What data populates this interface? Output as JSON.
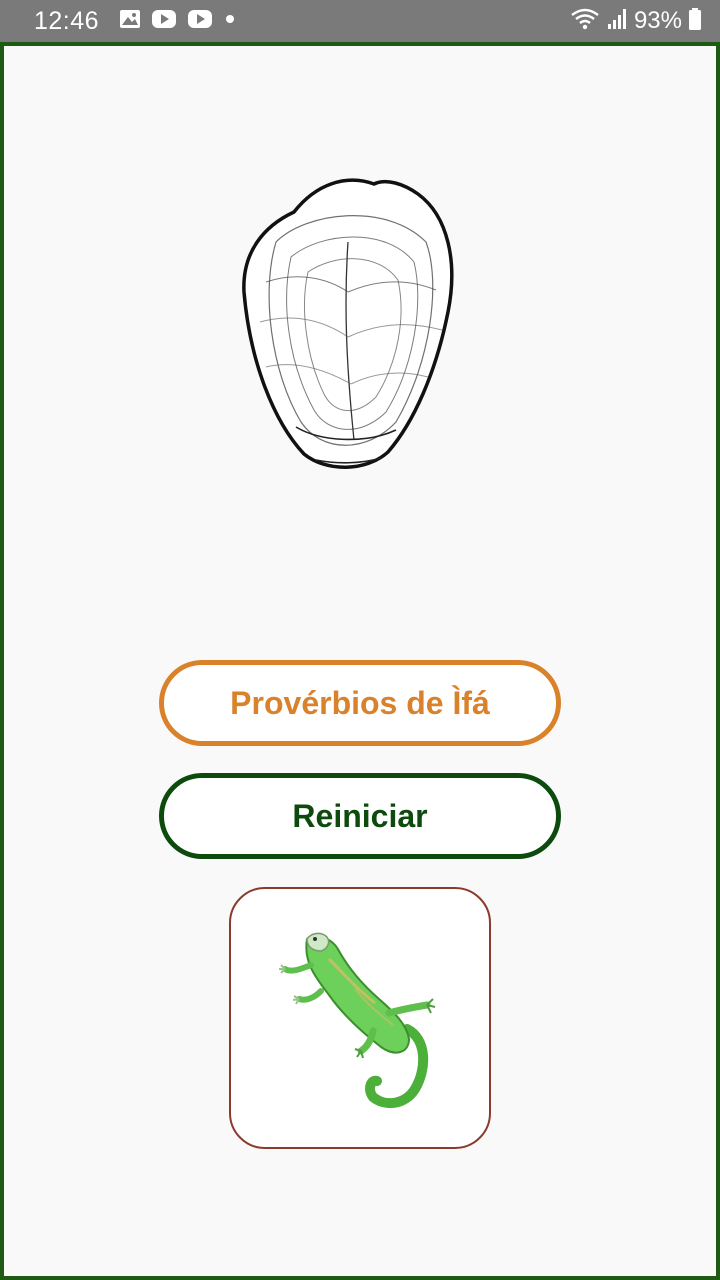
{
  "status_bar": {
    "time": "12:46",
    "battery": "93%",
    "icons": [
      "image-icon",
      "youtube-icon",
      "youtube-icon",
      "dot-icon",
      "wifi-icon",
      "signal-icon",
      "battery-icon"
    ]
  },
  "main": {
    "seed_image": "obi-seed-illustration",
    "proverbs_button_label": "Provérbios de Ìfá",
    "restart_button_label": "Reiniciar",
    "lizard_image": "lizard-illustration"
  },
  "colors": {
    "frame_border": "#1e5a12",
    "proverbs_accent": "#d9822b",
    "restart_accent": "#0d4a0d",
    "card_border": "#8b3a2e"
  }
}
